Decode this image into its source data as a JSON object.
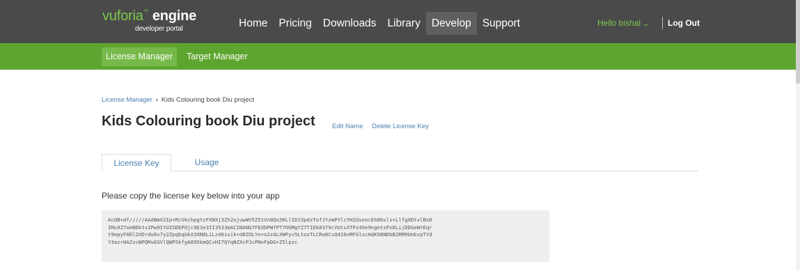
{
  "header": {
    "logo": {
      "brand": "vuforia",
      "tm": "™",
      "product": "engine",
      "subtitle": "developer portal"
    },
    "nav": [
      {
        "label": "Home",
        "active": false
      },
      {
        "label": "Pricing",
        "active": false
      },
      {
        "label": "Downloads",
        "active": false
      },
      {
        "label": "Library",
        "active": false
      },
      {
        "label": "Develop",
        "active": true
      },
      {
        "label": "Support",
        "active": false
      }
    ],
    "user_greeting": "Hello bishal",
    "logout_label": "Log Out"
  },
  "subnav": [
    {
      "label": "License Manager",
      "active": true
    },
    {
      "label": "Target Manager",
      "active": false
    }
  ],
  "breadcrumb": {
    "parent": "License Manager",
    "separator": "›",
    "current": "Kids Colouring book Diu project"
  },
  "page": {
    "title": "Kids Colouring book Diu project",
    "edit_name": "Edit Name",
    "delete_key": "Delete License Key"
  },
  "tabs": [
    {
      "label": "License Key",
      "active": true
    },
    {
      "label": "Usage",
      "active": false
    }
  ],
  "instructions": "Please copy the license key below into your app",
  "license_key_lines": [
    "AcOB+df/////AAABmX2Ip+M/UkchpgYzFXNXj3Zh2ojuwWV5Z51Vn8Qs5KLlIDJ3pdzTofJYzmPVlcYHZdsencEh8bsls+LlfgXDtvlBxD",
    "IMu9Z7oeNDktsIPw9IYUISDEPOjc9E3e3II3533mACINANU7FEXDPWfPT7OGMgYZ7T1Ek8379cVUtsXTPz49e9ngetzPzDLijDDGeWtEqr",
    "t9epyF6DlZdOrdu6v7y2ZpqbqGkX3XN0LiLz46isik+d8ZOLYn+o2zALXWPyv5LtozTLCRa8CsQ4I0xMFGlxcHdK98NDbB2RM9UebzpTYd",
    "Y3azrHAZzcWPQMvEGVlQWP5kfgA895kmQCvHI7QYqNZXcPJcPNnFpDG+Z5lpzc"
  ]
}
